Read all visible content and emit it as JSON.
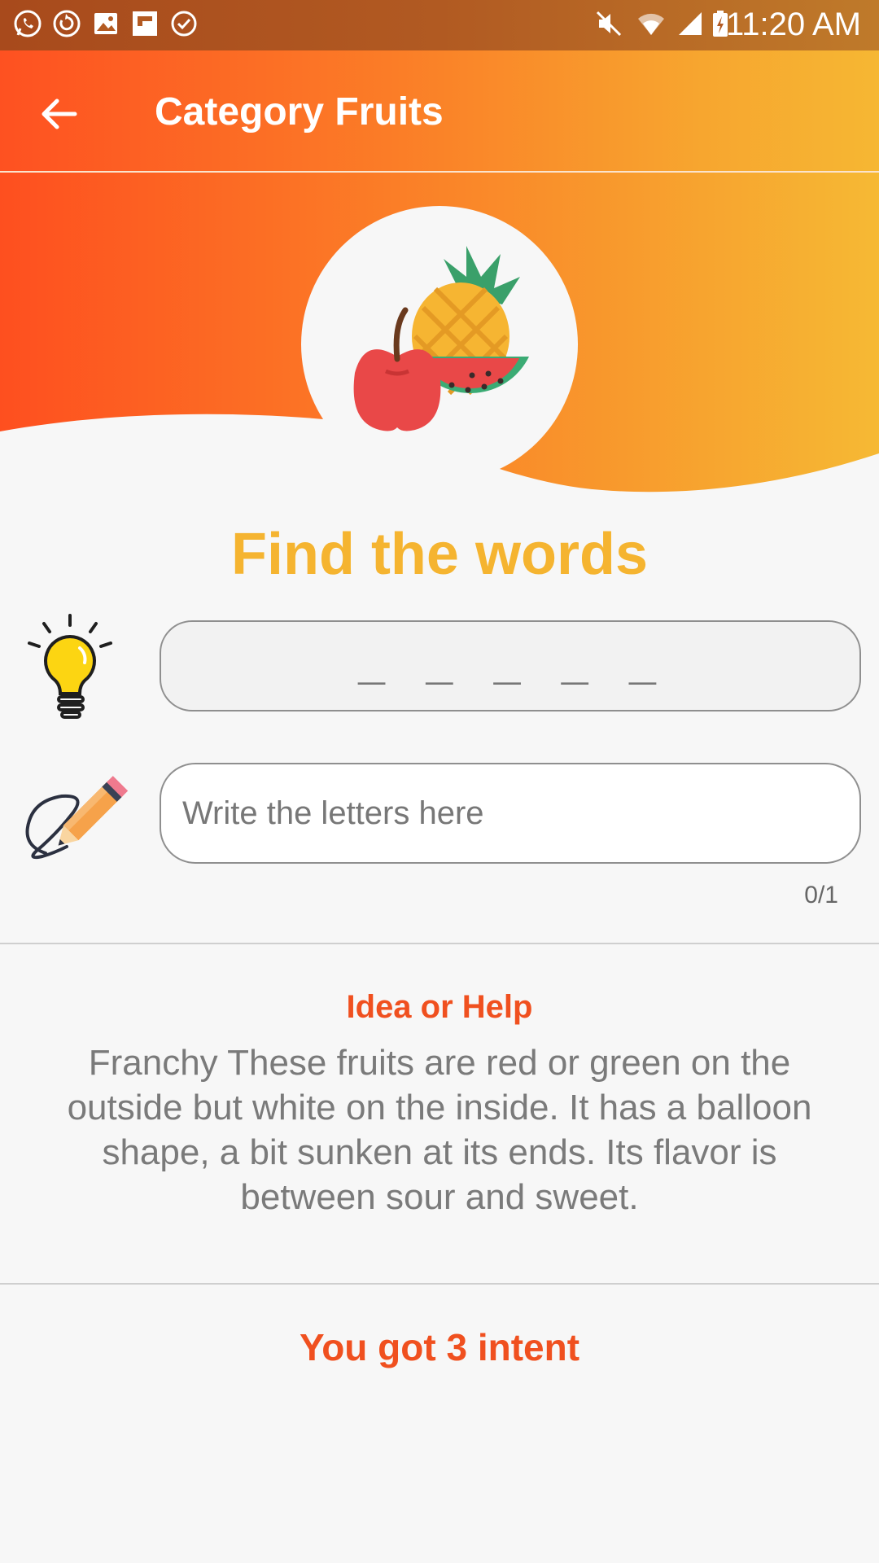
{
  "status_bar": {
    "time": "11:20 AM",
    "left_icons": [
      "whatsapp-icon",
      "sync-icon",
      "gallery-icon",
      "flipboard-icon",
      "check-circle-icon"
    ],
    "right_icons": [
      "mute-icon",
      "wifi-icon",
      "signal-icon",
      "battery-charging-icon"
    ]
  },
  "app_bar": {
    "title": "Category Fruits",
    "back_icon": "arrow-back-icon"
  },
  "colors": {
    "gradient_start": "#fe5121",
    "gradient_end": "#f6b733",
    "title_yellow": "#f5b430",
    "accent_red": "#f0501f"
  },
  "game": {
    "title": "Find the words",
    "hidden_word": "_ _ _ _ _",
    "input_placeholder": "Write the letters here",
    "input_value": "",
    "counter": "0/1"
  },
  "help": {
    "title": "Idea or Help",
    "text": "Franchy These fruits are red or green on the outside but white on the inside. It has a balloon shape, a bit sunken at its ends. Its flavor is between sour and sweet."
  },
  "attempts_text": "You got 3 intent"
}
